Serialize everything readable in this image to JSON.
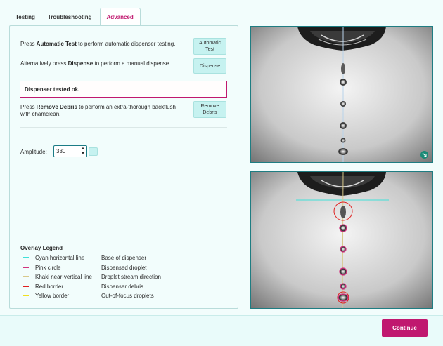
{
  "tabs": [
    {
      "label": "Testing"
    },
    {
      "label": "Troubleshooting"
    },
    {
      "label": "Advanced"
    }
  ],
  "advanced": {
    "auto_test": {
      "pre": "Press ",
      "bold": "Automatic Test",
      "post": " to perform automatic dispenser testing.",
      "button": "Automatic Test"
    },
    "dispense": {
      "pre": "Alternatively press ",
      "bold": "Dispense",
      "post": " to perform a manual dispense.",
      "button": "Dispense"
    },
    "status": "Dispenser tested ok.",
    "remove_debris": {
      "pre": "Press ",
      "bold": "Remove Debris",
      "post": " to perform an extra-thorough backflush with chamclean.",
      "button": "Remove Debris"
    },
    "amplitude": {
      "label": "Amplitude:",
      "value": "330"
    }
  },
  "legend": {
    "title": "Overlay Legend",
    "items": [
      {
        "name": "Cyan horizontal line",
        "meaning": "Base of dispenser",
        "color": "#40e0d8"
      },
      {
        "name": "Pink circle",
        "meaning": "Dispensed droplet",
        "color": "#d2337f"
      },
      {
        "name": "Khaki near-vertical line",
        "meaning": "Droplet stream direction",
        "color": "#d8c88a"
      },
      {
        "name": "Red border",
        "meaning": "Dispenser debris",
        "color": "#e0201f"
      },
      {
        "name": "Yellow border",
        "meaning": "Out-of-focus droplets",
        "color": "#f0e020"
      }
    ]
  },
  "footer": {
    "continue_label": "Continue"
  },
  "colors": {
    "accent": "#c0186f",
    "button_bg": "#c6f2f0",
    "panel_border": "#b9dcda"
  }
}
